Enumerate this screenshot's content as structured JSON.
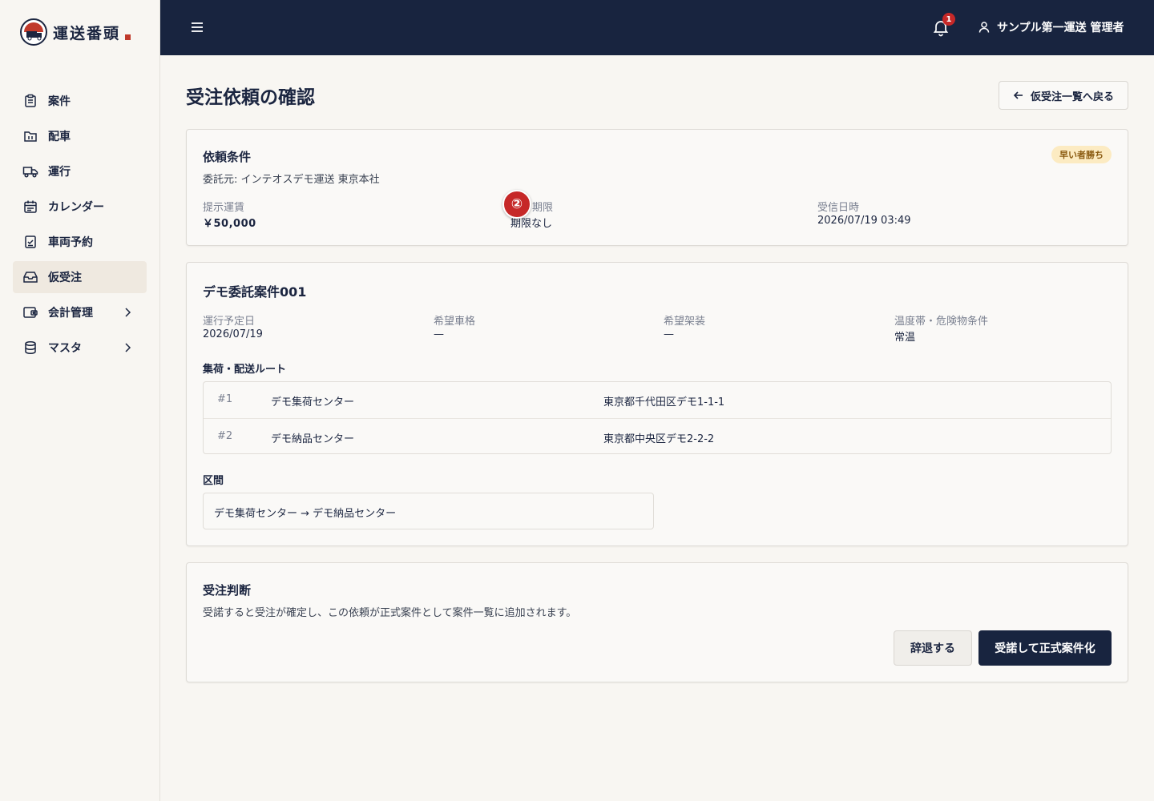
{
  "app": {
    "logo_text": "運送番頭"
  },
  "sidebar": {
    "items": [
      {
        "label": "案件",
        "icon": "clipboard-icon"
      },
      {
        "label": "配車",
        "icon": "folder-icon"
      },
      {
        "label": "運行",
        "icon": "truck-icon"
      },
      {
        "label": "カレンダー",
        "icon": "calendar-icon"
      },
      {
        "label": "車両予約",
        "icon": "clipboard-check-icon"
      },
      {
        "label": "仮受注",
        "icon": "inbox-icon",
        "active": true
      },
      {
        "label": "会計管理",
        "icon": "wallet-icon",
        "expandable": true
      },
      {
        "label": "マスタ",
        "icon": "database-icon",
        "expandable": true
      }
    ]
  },
  "header": {
    "notification_count": "1",
    "user_label": "サンプル第一運送 管理者"
  },
  "page": {
    "title": "受注依頼の確認",
    "back_label": "仮受注一覧へ戻る"
  },
  "request": {
    "title": "依頼条件",
    "consignor": "委託元: インテオスデモ運送 東京本社",
    "badge": "早い者勝ち",
    "step_marker": "②",
    "fare_label": "提示運賃",
    "fare_value": "￥50,000",
    "deadline_label": "期限",
    "deadline_value": "期限なし",
    "received_label": "受信日時",
    "received_value": "2026/07/19 03:49"
  },
  "case": {
    "title": "デモ委託案件001",
    "date_label": "運行予定日",
    "date_value": "2026/07/19",
    "vehicle_label": "希望車格",
    "vehicle_value": "—",
    "body_label": "希望架装",
    "body_value": "—",
    "temp_label": "温度帯・危険物条件",
    "temp_value": "常温",
    "route_title": "集荷・配送ルート",
    "routes": [
      {
        "no": "#1",
        "name": "デモ集荷センター",
        "address": "東京都千代田区デモ1-1-1"
      },
      {
        "no": "#2",
        "name": "デモ納品センター",
        "address": "東京都中央区デモ2-2-2"
      }
    ],
    "section_title": "区間",
    "section_value": "デモ集荷センター → デモ納品センター"
  },
  "decision": {
    "title": "受注判断",
    "description": "受諾すると受注が確定し、この依頼が正式案件として案件一覧に追加されます。",
    "decline_label": "辞退する",
    "accept_label": "受諾して正式案件化"
  },
  "colors": {
    "navy": "#18243f",
    "badge_bg": "#fcebc2",
    "badge_text": "#8a5a10",
    "alert_red": "#c62828"
  }
}
